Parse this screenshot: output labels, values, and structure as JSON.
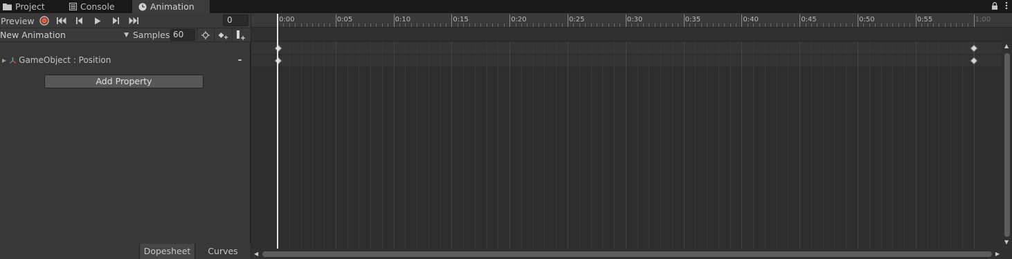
{
  "tabs": [
    {
      "label": "Project",
      "icon": "folder-icon"
    },
    {
      "label": "Console",
      "icon": "console-icon"
    },
    {
      "label": "Animation",
      "icon": "animation-clock-icon",
      "active": true
    }
  ],
  "toolbar": {
    "preview_label": "Preview",
    "current_frame": "0",
    "record_color": "#e2563a"
  },
  "clip": {
    "name": "New Animation",
    "samples_label": "Samples",
    "samples_value": "60"
  },
  "properties": [
    {
      "label": "GameObject : Position",
      "icon": "transform-gizmo-icon"
    }
  ],
  "add_property_label": "Add Property",
  "view_tabs": [
    {
      "label": "Dopesheet",
      "active": true
    },
    {
      "label": "Curves",
      "active": false
    }
  ],
  "ruler": {
    "labels": [
      "0:00",
      "0:05",
      "0:10",
      "0:15",
      "0:20",
      "0:25",
      "0:30",
      "0:35",
      "0:40",
      "0:45",
      "0:50",
      "0:55",
      "1:00"
    ]
  },
  "keyframes": {
    "start_frame": "0:00",
    "end_frame": "1:00"
  }
}
